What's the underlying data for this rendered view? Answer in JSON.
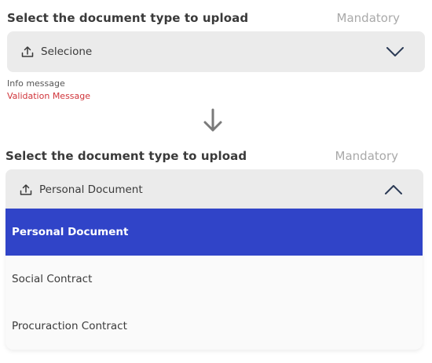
{
  "closed_field": {
    "label": "Select the document type to upload",
    "mandatory": "Mandatory",
    "value": "Selecione",
    "info_message": "Info message",
    "validation_message": "Validation Message"
  },
  "open_field": {
    "label": "Select the document type to upload",
    "mandatory": "Mandatory",
    "value": "Personal Document",
    "options": [
      {
        "label": "Personal Document",
        "selected": true
      },
      {
        "label": "Social Contract",
        "selected": false
      },
      {
        "label": "Procuraction Contract",
        "selected": false
      }
    ]
  },
  "colors": {
    "field_bg": "#ebebeb",
    "selected_bg": "#3044c8",
    "validation": "#d0343a",
    "mandatory": "#a9a9a9",
    "icon_navy": "#2b3a55"
  },
  "icons": {
    "upload": "upload-icon",
    "chevron_down": "chevron-down-icon",
    "chevron_up": "chevron-up-icon",
    "arrow_down": "arrow-down-icon"
  }
}
